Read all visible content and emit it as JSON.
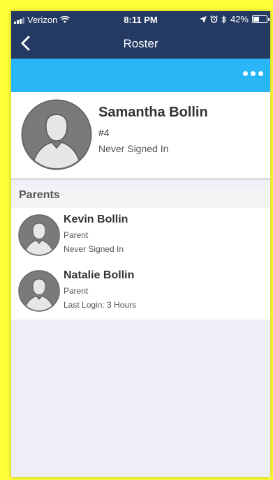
{
  "status_bar": {
    "carrier": "Verizon",
    "time": "8:11 PM",
    "battery_percent": "42%",
    "battery_level": 0.42,
    "icons": [
      "signal-icon",
      "wifi-icon",
      "location-icon",
      "alarm-icon",
      "bluetooth-icon",
      "battery-icon"
    ]
  },
  "nav": {
    "title": "Roster",
    "back_icon": "chevron-left-icon"
  },
  "toolbar": {
    "more_icon": "more-horizontal-icon",
    "color": "#28b6f6"
  },
  "player": {
    "name": "Samantha Bollin",
    "number": "#4",
    "status": "Never Signed In"
  },
  "parents_section": {
    "title": "Parents",
    "items": [
      {
        "name": "Kevin Bollin",
        "role": "Parent",
        "status": "Never Signed In"
      },
      {
        "name": "Natalie Bollin",
        "role": "Parent",
        "status": "Last Login: 3 Hours"
      }
    ]
  },
  "colors": {
    "nav_bg": "#243a63",
    "accent_blue": "#28b6f6",
    "frame_highlight": "#ffff3a",
    "list_bg": "#efeef6"
  }
}
